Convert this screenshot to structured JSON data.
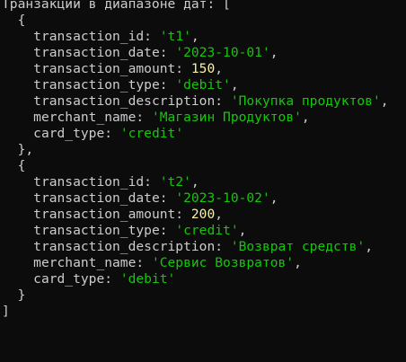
{
  "terminal": {
    "header": "Транзакции в диапазоне дат: [",
    "open_bracket": "{",
    "close_bracket_comma": "},",
    "close_bracket": "}",
    "list_close": "]",
    "keys": {
      "transaction_id": "transaction_id: ",
      "transaction_date": "transaction_date: ",
      "transaction_amount": "transaction_amount: ",
      "transaction_type": "transaction_type: ",
      "transaction_description": "transaction_description: ",
      "merchant_name": "merchant_name: ",
      "card_type": "card_type: "
    },
    "transactions": [
      {
        "transaction_id": "'t1'",
        "transaction_date": "'2023-10-01'",
        "transaction_amount": "150",
        "transaction_type": "'debit'",
        "transaction_description": "'Покупка продуктов'",
        "merchant_name": "'Магазин Продуктов'",
        "card_type": "'credit'"
      },
      {
        "transaction_id": "'t2'",
        "transaction_date": "'2023-10-02'",
        "transaction_amount": "200",
        "transaction_type": "'credit'",
        "transaction_description": "'Возврат средств'",
        "merchant_name": "'Сервис Возвратов'",
        "card_type": "'debit'"
      }
    ]
  },
  "colors": {
    "background": "#0c0c0c",
    "text": "#cccccc",
    "string": "#16c60c",
    "number": "#f9f1a5"
  }
}
